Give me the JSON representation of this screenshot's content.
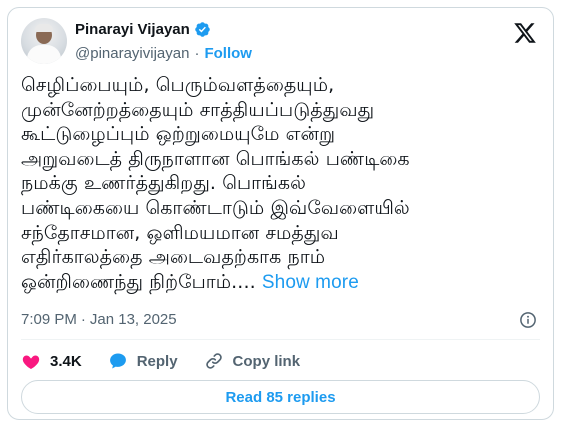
{
  "author": {
    "display_name": "Pinarayi Vijayan",
    "handle": "@pinarayivijayan",
    "separator": "·",
    "follow_label": "Follow"
  },
  "tweet": {
    "lines": [
      "செழிப்பையும், பெரும்வளத்தையும்,",
      "முன்னேற்றத்தையும் சாத்தியப்படுத்துவது",
      "கூட்டுழைப்பும் ஒற்றுமையுமே என்று",
      "அறுவடைத் திருநாளான பொங்கல் பண்டிகை",
      "நமக்கு உணர்த்துகிறது. பொங்கல்",
      "பண்டிகையை கொண்டாடும் இவ்வேளையில்",
      "சந்தோசமான, ஒளிமயமான சமத்துவ",
      "எதிர்காலத்தை அடைவதற்காக நாம்",
      "ஒன்றிணைந்து நிற்போம்...."
    ],
    "show_more_label": "Show more",
    "time": "7:09 PM",
    "meta_separator": "·",
    "date": "Jan 13, 2025"
  },
  "actions": {
    "likes_count": "3.4K",
    "reply_label": "Reply",
    "copy_link_label": "Copy link"
  },
  "read_replies_label": "Read 85 replies",
  "colors": {
    "accent": "#1d9bf0",
    "like": "#f91880",
    "text": "#0f1419",
    "secondary": "#536471",
    "border": "#cfd9de"
  },
  "icons": [
    "verified-badge-icon",
    "x-logo-icon",
    "info-icon",
    "heart-icon",
    "reply-bubble-icon",
    "link-icon"
  ]
}
